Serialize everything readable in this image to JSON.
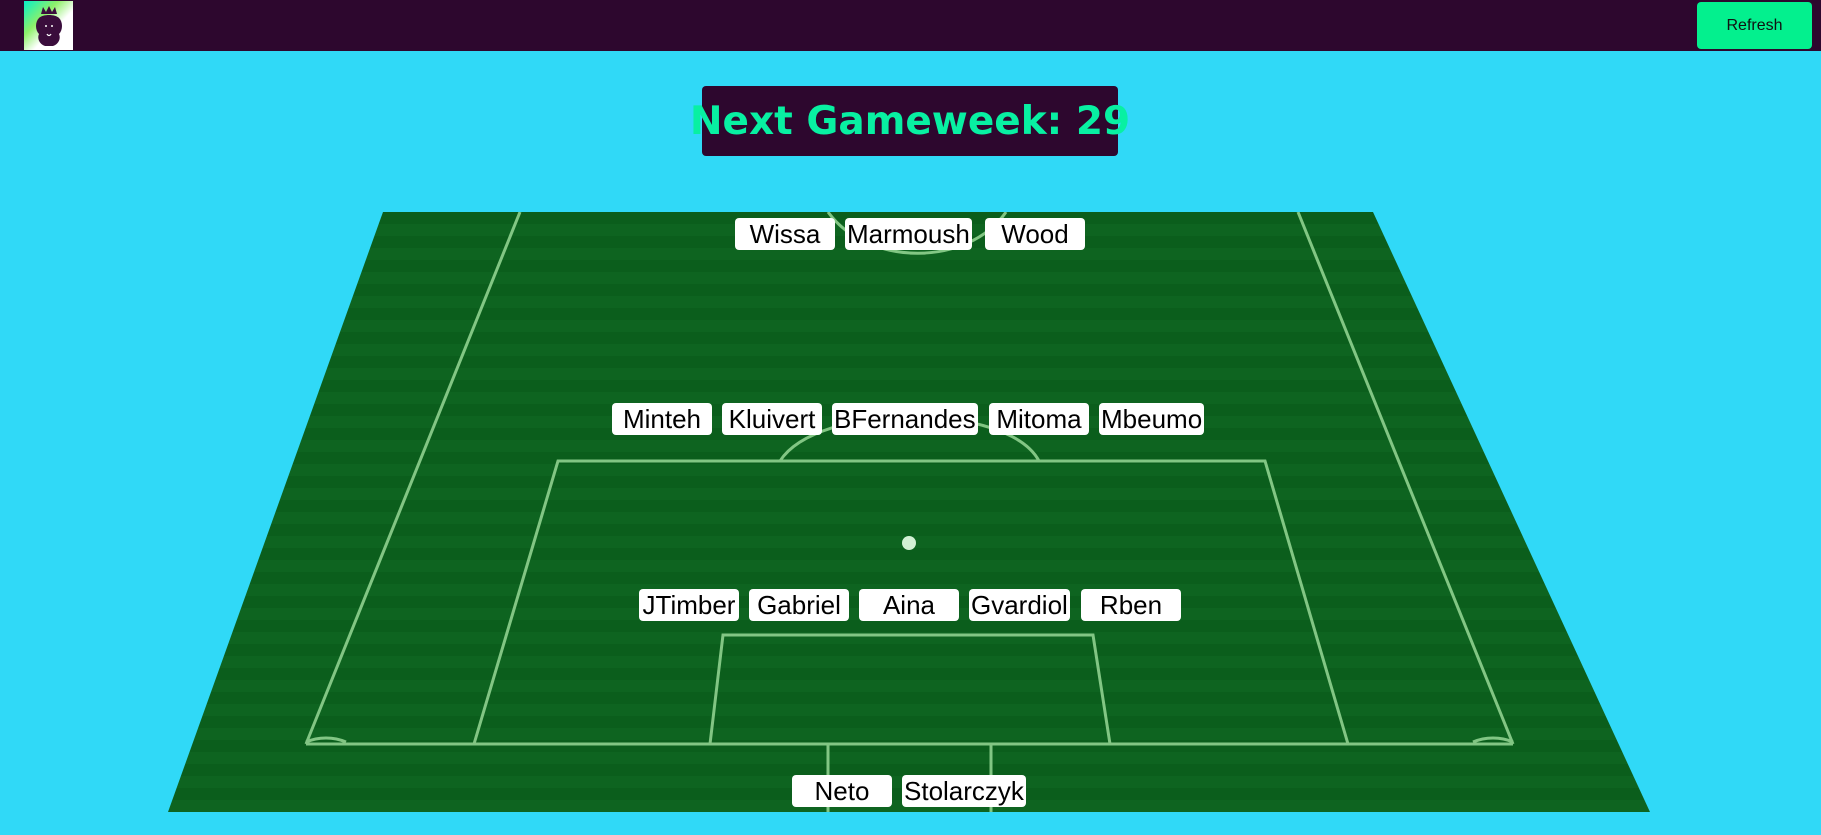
{
  "header": {
    "logo_name": "premier-league-lion-logo",
    "refresh_label": "Refresh"
  },
  "gameweek": {
    "label": "Next Gameweek: 29"
  },
  "colors": {
    "background": "#30d9f7",
    "header": "#2d072e",
    "accent": "#08f0a2",
    "refresh_button": "#03f08e",
    "pitch": "#0b5e1c"
  },
  "lineup": {
    "forwards": [
      "Wissa",
      "Marmoush",
      "Wood"
    ],
    "midfielders": [
      "Minteh",
      "Kluivert",
      "BFernandes",
      "Mitoma",
      "Mbeumo"
    ],
    "defenders": [
      "JTimber",
      "Gabriel",
      "Aina",
      "Gvardiol",
      "Rben"
    ],
    "goalkeepers": [
      "Neto",
      "Stolarczyk"
    ]
  }
}
